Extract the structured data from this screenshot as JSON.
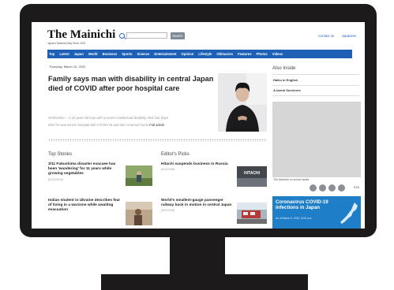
{
  "site": {
    "logo": "The Mainichi",
    "tagline": "Japan's National Daily Since 1922",
    "search_button": "Search",
    "header_links": [
      "Contact us",
      "Japanese"
    ]
  },
  "nav": [
    "Top",
    "Latest",
    "Japan",
    "World",
    "Business",
    "Sports",
    "Science",
    "Entertainment",
    "Opinion",
    "Lifestyle",
    "Obituaries",
    "Features",
    "Photos",
    "Videos"
  ],
  "main": {
    "date": "Thursday, March 10, 2022",
    "headline": "Family says man with disability in central Japan died of COVID after poor hospital care",
    "lede_lines": [
      "SHIZUOKA -- A 24-year-old man with a severe intellectual disability died four days",
      "after he was sent to hospital with COVID-19 and then returned home"
    ],
    "full_article": "Full article"
  },
  "top_stories": {
    "title": "Top Stories",
    "items": [
      {
        "headline": "3/11 Fukushima disaster evacuee has been 'wandering' for 11 years while growing vegetables",
        "date": "(2022/3/10)"
      },
      {
        "headline": "Indian student in Ukraine describes fear of living in a warzone while awaiting evacuation",
        "date": ""
      }
    ]
  },
  "editors_picks": {
    "title": "Editor's Picks",
    "items": [
      {
        "headline": "Hitachi suspends business in Russia",
        "date": "(2022/3/9)",
        "thumb_text": "HITACHI"
      },
      {
        "headline": "World's smallest-gauge passenger railway back in motion in central Japan",
        "date": "(2022/3/9)"
      }
    ]
  },
  "sidebar": {
    "title": "Also Inside",
    "links": [
      "Haiku in English",
      "A-bomb Survivors"
    ],
    "social_text": "The Mainichi on social media",
    "rss": "RSS",
    "covid": {
      "title": "Coronavirus COVID-19 infections in Japan",
      "subtitle": "As of March 9, 2022, 8:00 p.m."
    }
  },
  "colors": {
    "nav": "#1d60b6",
    "bezel": "#1c1a1a",
    "link": "#2b66c4",
    "covid": "#1e7ec8"
  }
}
